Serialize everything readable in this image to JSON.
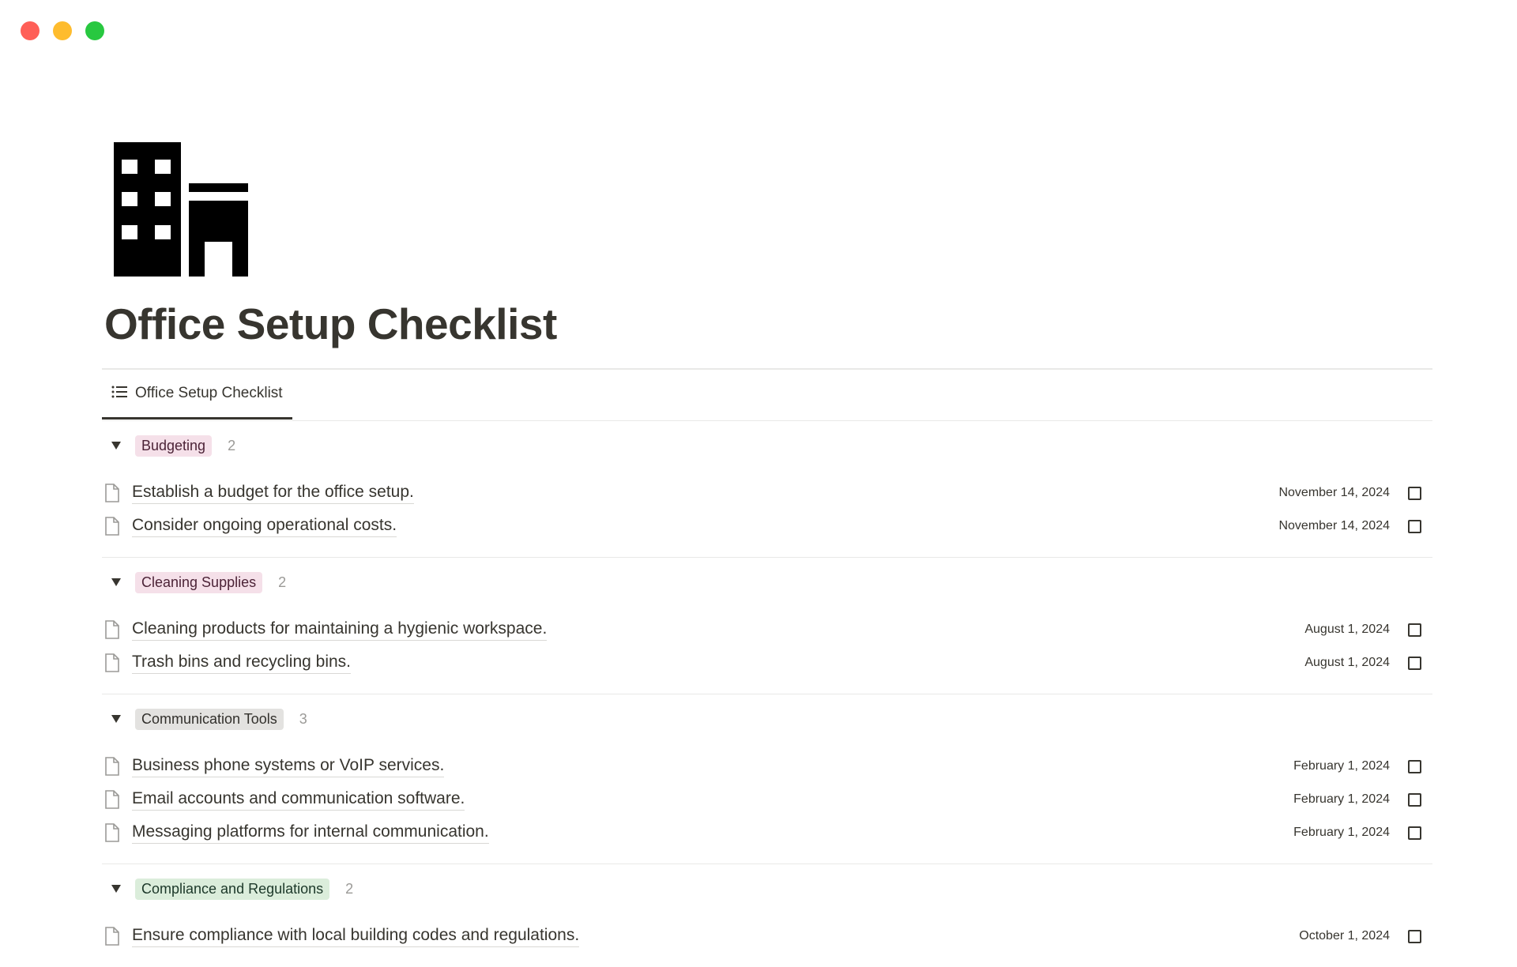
{
  "window": {
    "controls": [
      {
        "name": "close",
        "color": "#ff5f57"
      },
      {
        "name": "minimize",
        "color": "#febc2e"
      },
      {
        "name": "zoom",
        "color": "#28c840"
      }
    ]
  },
  "page": {
    "icon": "office-building-icon",
    "title": "Office Setup Checklist"
  },
  "view": {
    "tab_label": "Office Setup Checklist",
    "tab_icon": "list-icon"
  },
  "groups": [
    {
      "tag": "Budgeting",
      "tag_bg": "#f5e0e9",
      "tag_color": "#4c2337",
      "count": "2",
      "items": [
        {
          "title": "Establish a budget for the office setup.",
          "date": "November 14, 2024",
          "checked": false
        },
        {
          "title": "Consider ongoing operational costs.",
          "date": "November 14, 2024",
          "checked": false
        }
      ]
    },
    {
      "tag": "Cleaning Supplies",
      "tag_bg": "#f5e0e9",
      "tag_color": "#4c2337",
      "count": "2",
      "items": [
        {
          "title": "Cleaning products for maintaining a hygienic workspace.",
          "date": "August 1, 2024",
          "checked": false
        },
        {
          "title": "Trash bins and recycling bins.",
          "date": "August 1, 2024",
          "checked": false
        }
      ]
    },
    {
      "tag": "Communication Tools",
      "tag_bg": "#e3e2e0",
      "tag_color": "#32302c",
      "count": "3",
      "items": [
        {
          "title": "Business phone systems or VoIP services.",
          "date": "February 1, 2024",
          "checked": false
        },
        {
          "title": "Email accounts and communication software.",
          "date": "February 1, 2024",
          "checked": false
        },
        {
          "title": "Messaging platforms for internal communication.",
          "date": "February 1, 2024",
          "checked": false
        }
      ]
    },
    {
      "tag": "Compliance and Regulations",
      "tag_bg": "#dbeddb",
      "tag_color": "#1c3829",
      "count": "2",
      "items": [
        {
          "title": "Ensure compliance with local building codes and regulations.",
          "date": "October 1, 2024",
          "checked": false
        }
      ]
    }
  ]
}
